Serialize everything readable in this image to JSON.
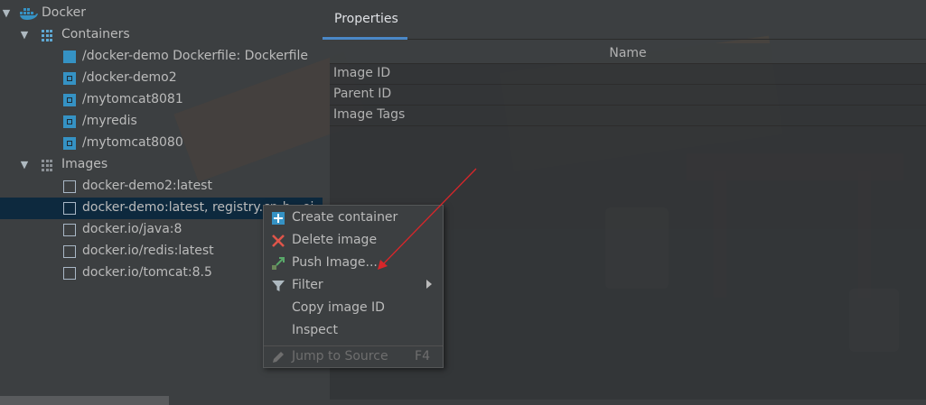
{
  "tree": {
    "root": {
      "label": "Docker"
    },
    "containers": {
      "label": "Containers",
      "items": [
        {
          "label": "/docker-demo Dockerfile: Dockerfile",
          "icon": "container-stopped-icon"
        },
        {
          "label": "/docker-demo2",
          "icon": "container-running-icon"
        },
        {
          "label": "/mytomcat8081",
          "icon": "container-running-icon"
        },
        {
          "label": "/myredis",
          "icon": "container-running-icon"
        },
        {
          "label": "/mytomcat8080",
          "icon": "container-running-icon"
        }
      ]
    },
    "images": {
      "label": "Images",
      "items": [
        {
          "label": "docker-demo2:latest"
        },
        {
          "label": "docker-demo:latest, registry.cn-h...ei"
        },
        {
          "label": "docker.io/java:8"
        },
        {
          "label": "docker.io/redis:latest"
        },
        {
          "label": "docker.io/tomcat:8.5"
        }
      ]
    }
  },
  "properties": {
    "tab_label": "Properties",
    "header": "Name",
    "rows": [
      "Image ID",
      "Parent ID",
      "Image Tags"
    ]
  },
  "context_menu": {
    "items": [
      {
        "label": "Create container",
        "icon": "plus-icon"
      },
      {
        "label": "Delete image",
        "icon": "delete-x-icon"
      },
      {
        "label": "Push Image...",
        "icon": "push-arrow-icon"
      },
      {
        "label": "Filter",
        "icon": "filter-funnel-icon"
      },
      {
        "label": "Copy image ID"
      },
      {
        "label": "Inspect"
      }
    ],
    "jump": {
      "label": "Jump to Source",
      "shortcut": "F4"
    }
  },
  "colors": {
    "accent": "#4a88c7",
    "selection": "#0d293e",
    "docker_blue": "#3592c4",
    "annotation_red": "#d9262a"
  }
}
